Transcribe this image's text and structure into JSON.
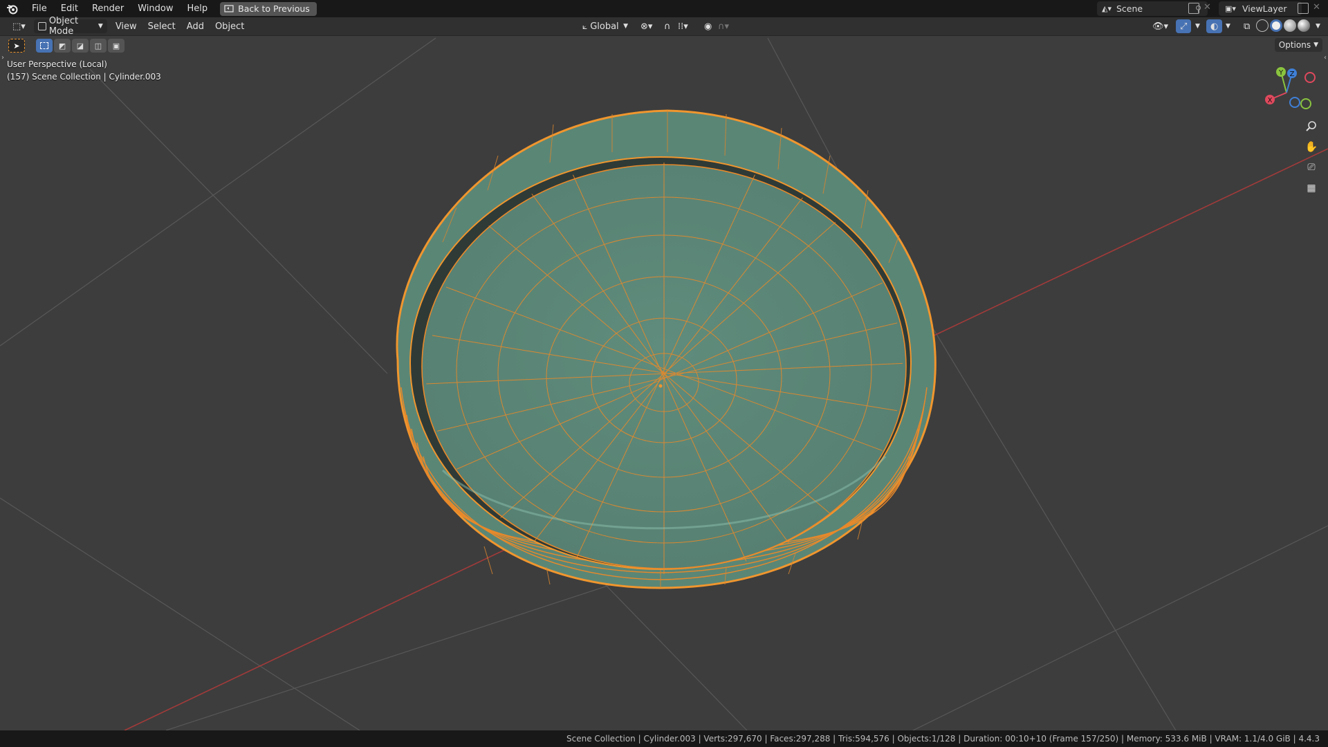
{
  "topbar": {
    "menus": [
      "File",
      "Edit",
      "Render",
      "Window",
      "Help"
    ],
    "back_button": "Back to Previous",
    "scene": "Scene",
    "view_layer": "ViewLayer"
  },
  "header": {
    "mode": "Object Mode",
    "menus": [
      "View",
      "Select",
      "Add",
      "Object"
    ],
    "transform_orientation": "Global",
    "options": "Options"
  },
  "viewport": {
    "perspective": "User Perspective (Local)",
    "collection_info": "(157) Scene Collection | Cylinder.003"
  },
  "gizmo": {
    "x_label": "X",
    "y_label": "Y",
    "z_label": "Z",
    "x_color": "#e0495d",
    "y_color": "#8ac43f",
    "z_color": "#3f80d8"
  },
  "status": {
    "text": "Scene Collection | Cylinder.003 | Verts:297,670 | Faces:297,288 | Tris:594,576 | Objects:1/128 | Duration: 00:10+10 (Frame 157/250) | Memory: 533.6 MiB | VRAM: 1.1/4.0 GiB | 4.4.3"
  },
  "colors": {
    "selection_outline": "#f0962e",
    "mesh_fill": "#5f8c7c",
    "x_axis_line": "#a33a3a",
    "grid_line": "#555555"
  }
}
